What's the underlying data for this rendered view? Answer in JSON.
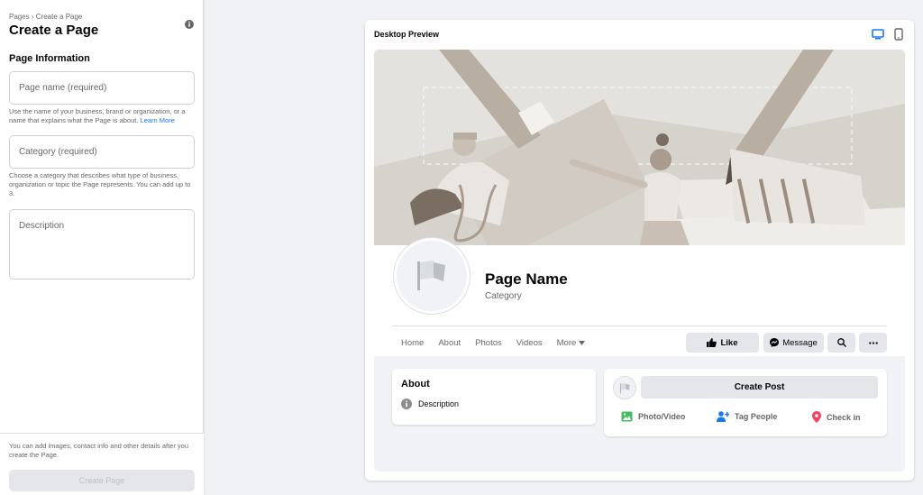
{
  "left_panel": {
    "breadcrumb": "Pages › Create a Page",
    "title": "Create a Page",
    "section_title": "Page Information",
    "page_name_placeholder": "Page name (required)",
    "page_name_help": "Use the name of your business, brand or organization, or a name that explains what the Page is about.",
    "learn_more": "Learn More",
    "category_placeholder": "Category (required)",
    "category_help": "Choose a category that describes what type of business, organization or topic the Page represents. You can add up to 3.",
    "description_placeholder": "Description",
    "bottom_text": "You can add images, contact info and other details after you create the Page.",
    "create_button": "Create Page"
  },
  "preview": {
    "label": "Desktop Preview",
    "page_name": "Page Name",
    "category": "Category",
    "tabs": [
      "Home",
      "About",
      "Photos",
      "Videos",
      "More"
    ],
    "like": "Like",
    "message": "Message",
    "about_title": "About",
    "about_description": "Description",
    "create_post": "Create Post",
    "actions": [
      "Photo/Video",
      "Tag People",
      "Check in"
    ]
  },
  "colors": {
    "accent": "#1877f2",
    "photo_green": "#45bd62",
    "tag_blue": "#1877f2",
    "checkin_red": "#f3425f"
  }
}
